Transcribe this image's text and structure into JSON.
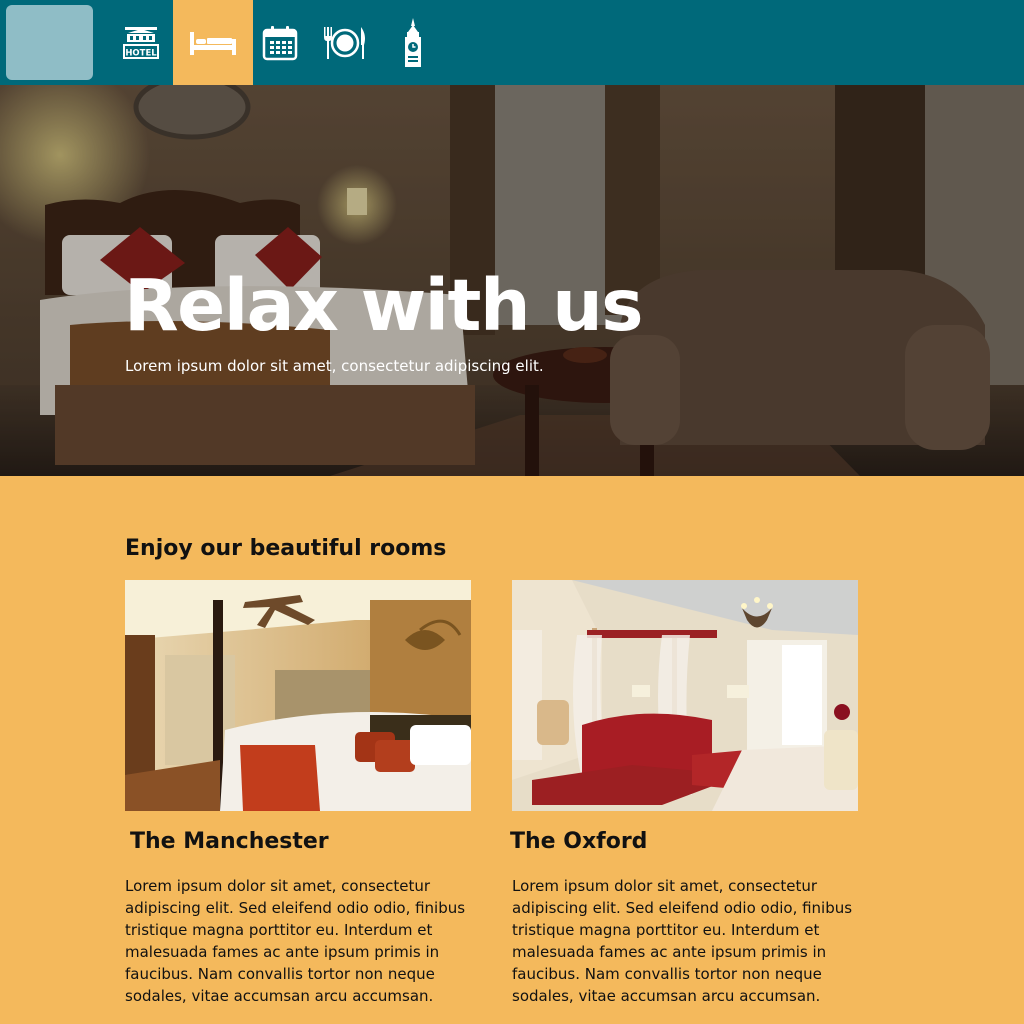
{
  "nav": {
    "items": [
      {
        "icon": "hotel-sign-icon",
        "label": "HOTEL"
      },
      {
        "icon": "bed-icon",
        "active": true
      },
      {
        "icon": "calendar-icon"
      },
      {
        "icon": "dining-icon"
      },
      {
        "icon": "clock-tower-icon"
      }
    ]
  },
  "hero": {
    "title": "Relax with us",
    "subtitle": "Lorem ipsum dolor sit amet, consectetur adipiscing elit."
  },
  "rooms_section": {
    "heading": "Enjoy our beautiful rooms",
    "rooms": [
      {
        "name": "The Manchester",
        "description": "Lorem ipsum dolor sit amet, consectetur adipiscing elit. Sed eleifend odio odio, finibus tristique magna porttitor eu. Interdum et malesuada fames ac ante ipsum primis in faucibus. Nam convallis tortor non neque sodales, vitae accumsan arcu accumsan."
      },
      {
        "name": "The Oxford",
        "description": "Lorem ipsum dolor sit amet, consectetur adipiscing elit. Sed eleifend odio odio, finibus tristique magna porttitor eu. Interdum et malesuada fames ac ante ipsum primis in faucibus. Nam convallis tortor non neque sodales, vitae accumsan arcu accumsan."
      }
    ]
  },
  "colors": {
    "nav_background": "#00697a",
    "accent": "#f4b95c",
    "logo_placeholder": "#8fbdc6"
  }
}
